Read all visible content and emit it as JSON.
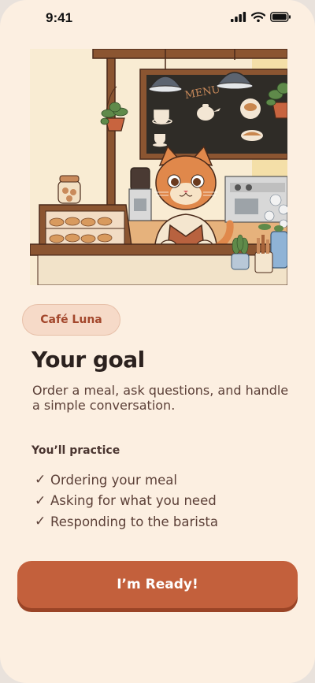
{
  "status_bar": {
    "time": "9:41"
  },
  "illustration": {
    "menu_board_text": "MENU"
  },
  "badge": {
    "label": "Café Luna"
  },
  "goal": {
    "title": "Your goal",
    "description": "Order a meal, ask questions, and handle a simple conversation."
  },
  "practice": {
    "heading": "You’ll practice",
    "check_glyph": "✓",
    "items": [
      "Ordering your meal",
      "Asking for what you need",
      "Responding to the barista"
    ]
  },
  "cta": {
    "label": "I’m Ready!"
  },
  "colors": {
    "background": "#fcefe1",
    "accent": "#c3603c",
    "accent_shadow": "#9a4426",
    "badge_bg": "#f6dac8",
    "badge_text": "#a3472c",
    "title": "#2b211e"
  }
}
